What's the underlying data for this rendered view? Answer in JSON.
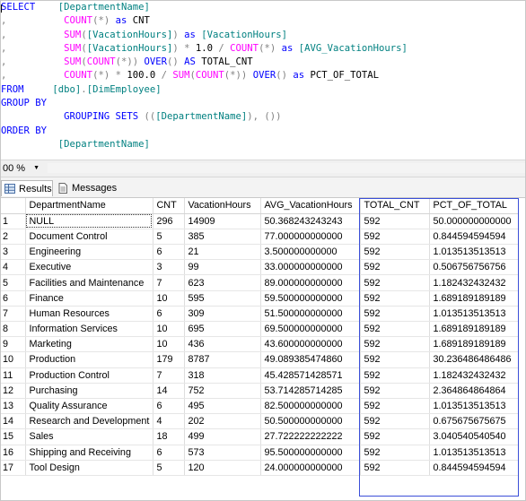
{
  "sql": {
    "lines": [
      [
        {
          "c": "kw",
          "t": "SELECT"
        },
        {
          "c": "id",
          "t": "    [DepartmentName]"
        }
      ],
      [
        {
          "c": "gr",
          "t": ",          "
        },
        {
          "c": "fn",
          "t": "COUNT"
        },
        {
          "c": "gr",
          "t": "(*)"
        },
        {
          "c": "kw",
          "t": " as "
        },
        {
          "c": "bk",
          "t": "CNT"
        }
      ],
      [
        {
          "c": "gr",
          "t": ",          "
        },
        {
          "c": "fn",
          "t": "SUM"
        },
        {
          "c": "gr",
          "t": "("
        },
        {
          "c": "id",
          "t": "[VacationHours]"
        },
        {
          "c": "gr",
          "t": ")"
        },
        {
          "c": "kw",
          "t": " as "
        },
        {
          "c": "id",
          "t": "[VacationHours]"
        }
      ],
      [
        {
          "c": "gr",
          "t": ",          "
        },
        {
          "c": "fn",
          "t": "SUM"
        },
        {
          "c": "gr",
          "t": "("
        },
        {
          "c": "id",
          "t": "[VacationHours]"
        },
        {
          "c": "gr",
          "t": ") * "
        },
        {
          "c": "bk",
          "t": "1.0"
        },
        {
          "c": "gr",
          "t": " / "
        },
        {
          "c": "fn",
          "t": "COUNT"
        },
        {
          "c": "gr",
          "t": "(*)"
        },
        {
          "c": "kw",
          "t": " as "
        },
        {
          "c": "id",
          "t": "[AVG_VacationHours]"
        }
      ],
      [
        {
          "c": "gr",
          "t": ",          "
        },
        {
          "c": "fn",
          "t": "SUM"
        },
        {
          "c": "gr",
          "t": "("
        },
        {
          "c": "fn",
          "t": "COUNT"
        },
        {
          "c": "gr",
          "t": "(*)) "
        },
        {
          "c": "kw",
          "t": "OVER"
        },
        {
          "c": "gr",
          "t": "() "
        },
        {
          "c": "kw",
          "t": "AS"
        },
        {
          "c": "bk",
          "t": " TOTAL_CNT"
        }
      ],
      [
        {
          "c": "gr",
          "t": ",          "
        },
        {
          "c": "fn",
          "t": "COUNT"
        },
        {
          "c": "gr",
          "t": "(*) * "
        },
        {
          "c": "bk",
          "t": "100.0"
        },
        {
          "c": "gr",
          "t": " / "
        },
        {
          "c": "fn",
          "t": "SUM"
        },
        {
          "c": "gr",
          "t": "("
        },
        {
          "c": "fn",
          "t": "COUNT"
        },
        {
          "c": "gr",
          "t": "(*)) "
        },
        {
          "c": "kw",
          "t": "OVER"
        },
        {
          "c": "gr",
          "t": "() "
        },
        {
          "c": "kw",
          "t": "as"
        },
        {
          "c": "bk",
          "t": " PCT_OF_TOTAL"
        }
      ],
      [
        {
          "c": "kw",
          "t": "FROM"
        },
        {
          "c": "id",
          "t": "     [dbo]"
        },
        {
          "c": "gr",
          "t": "."
        },
        {
          "c": "id",
          "t": "[DimEmployee]"
        }
      ],
      [
        {
          "c": "kw",
          "t": "GROUP BY"
        }
      ],
      [
        {
          "c": "kw",
          "t": "           GROUPING SETS "
        },
        {
          "c": "gr",
          "t": "(("
        },
        {
          "c": "id",
          "t": "[DepartmentName]"
        },
        {
          "c": "gr",
          "t": "), ())"
        }
      ],
      [
        {
          "c": "kw",
          "t": "ORDER BY"
        }
      ],
      [
        {
          "c": "id",
          "t": "          [DepartmentName]"
        }
      ]
    ]
  },
  "zoom": {
    "value": "00 %"
  },
  "tabs": {
    "results": "Results",
    "messages": "Messages"
  },
  "grid": {
    "columns": [
      "DepartmentName",
      "CNT",
      "VacationHours",
      "AVG_VacationHours",
      "TOTAL_CNT",
      "PCT_OF_TOTAL"
    ],
    "rows": [
      [
        "1",
        "NULL",
        "296",
        "14909",
        "50.368243243243",
        "592",
        "50.000000000000"
      ],
      [
        "2",
        "Document Control",
        "5",
        "385",
        "77.000000000000",
        "592",
        "0.844594594594"
      ],
      [
        "3",
        "Engineering",
        "6",
        "21",
        "3.500000000000",
        "592",
        "1.013513513513"
      ],
      [
        "4",
        "Executive",
        "3",
        "99",
        "33.000000000000",
        "592",
        "0.506756756756"
      ],
      [
        "5",
        "Facilities and Maintenance",
        "7",
        "623",
        "89.000000000000",
        "592",
        "1.182432432432"
      ],
      [
        "6",
        "Finance",
        "10",
        "595",
        "59.500000000000",
        "592",
        "1.689189189189"
      ],
      [
        "7",
        "Human Resources",
        "6",
        "309",
        "51.500000000000",
        "592",
        "1.013513513513"
      ],
      [
        "8",
        "Information Services",
        "10",
        "695",
        "69.500000000000",
        "592",
        "1.689189189189"
      ],
      [
        "9",
        "Marketing",
        "10",
        "436",
        "43.600000000000",
        "592",
        "1.689189189189"
      ],
      [
        "10",
        "Production",
        "179",
        "8787",
        "49.089385474860",
        "592",
        "30.236486486486"
      ],
      [
        "11",
        "Production Control",
        "7",
        "318",
        "45.428571428571",
        "592",
        "1.182432432432"
      ],
      [
        "12",
        "Purchasing",
        "14",
        "752",
        "53.714285714285",
        "592",
        "2.364864864864"
      ],
      [
        "13",
        "Quality Assurance",
        "6",
        "495",
        "82.500000000000",
        "592",
        "1.013513513513"
      ],
      [
        "14",
        "Research and Development",
        "4",
        "202",
        "50.500000000000",
        "592",
        "0.675675675675"
      ],
      [
        "15",
        "Sales",
        "18",
        "499",
        "27.722222222222",
        "592",
        "3.040540540540"
      ],
      [
        "16",
        "Shipping and Receiving",
        "6",
        "573",
        "95.500000000000",
        "592",
        "1.013513513513"
      ],
      [
        "17",
        "Tool Design",
        "5",
        "120",
        "24.000000000000",
        "592",
        "0.844594594594"
      ]
    ]
  },
  "colors": {
    "highlight": "#3b4fd8",
    "keyword": "#0000ff",
    "function": "#ff00ff",
    "identifier": "#008080",
    "operator": "#808080"
  }
}
